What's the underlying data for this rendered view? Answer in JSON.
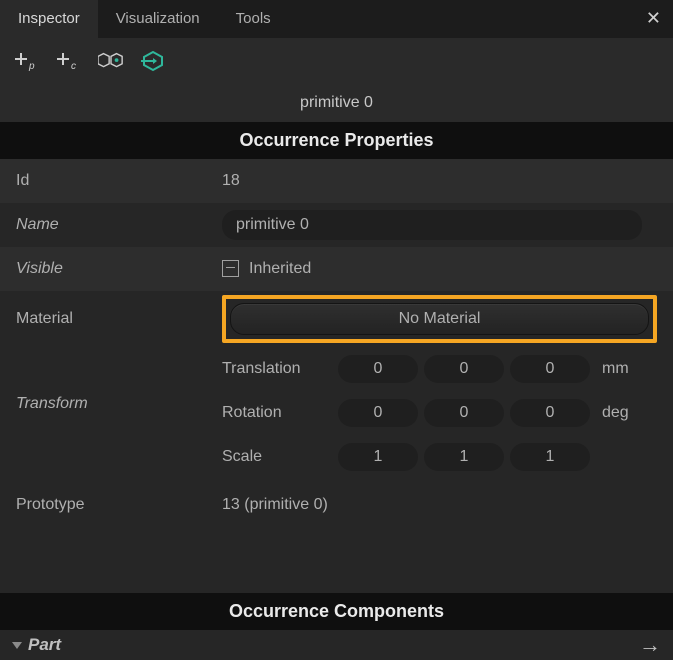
{
  "tabs": {
    "inspector": "Inspector",
    "visualization": "Visualization",
    "tools": "Tools"
  },
  "object_name": "primitive 0",
  "sections": {
    "properties": "Occurrence Properties",
    "components": "Occurrence Components"
  },
  "labels": {
    "id": "Id",
    "name": "Name",
    "visible": "Visible",
    "material": "Material",
    "transform": "Transform",
    "prototype": "Prototype",
    "translation": "Translation",
    "rotation": "Rotation",
    "scale": "Scale",
    "part": "Part"
  },
  "values": {
    "id": "18",
    "name": "primitive 0",
    "visible": "Inherited",
    "material_button": "No Material",
    "translation": [
      "0",
      "0",
      "0"
    ],
    "rotation": [
      "0",
      "0",
      "0"
    ],
    "scale": [
      "1",
      "1",
      "1"
    ],
    "units": {
      "translation": "mm",
      "rotation": "deg",
      "scale": ""
    },
    "prototype": "13 (primitive 0)"
  }
}
